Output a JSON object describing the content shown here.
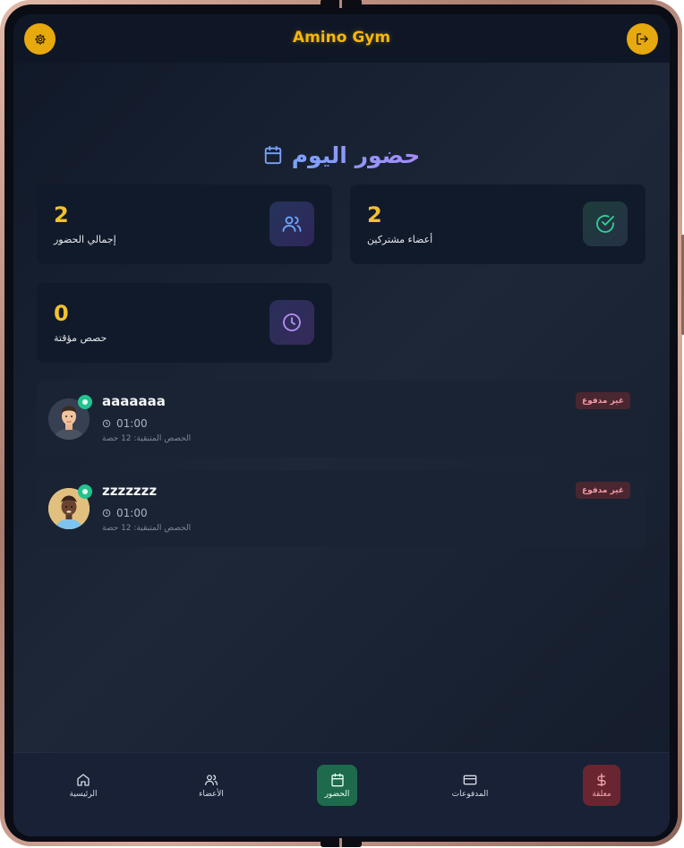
{
  "header": {
    "title": "Amino Gym",
    "settings_icon": "gear-icon",
    "logout_icon": "logout-icon",
    "accent_color": "#e6a90e"
  },
  "page": {
    "title": "حضور اليوم",
    "title_icon": "calendar-icon"
  },
  "stats": [
    {
      "value": "2",
      "label": "إجمالي الحضور",
      "icon": "users-icon"
    },
    {
      "value": "2",
      "label": "أعضاء مشتركين",
      "icon": "check-circle-icon"
    },
    {
      "value": "0",
      "label": "حصص مؤقتة",
      "icon": "clock-icon"
    }
  ],
  "attendance": [
    {
      "name": "aaaaaaa",
      "time": "01:00",
      "sessions": "الحصص المتبقية: 12 حصة",
      "status": "غير مدفوع"
    },
    {
      "name": "zzzzzzz",
      "time": "01:00",
      "sessions": "الحصص المتبقية: 12 حصة",
      "status": "غير مدفوع"
    }
  ],
  "nav": {
    "home": "الرئيسية",
    "members": "الأعضاء",
    "attendance": "الحضور",
    "payments": "المدفوعات",
    "pending": "معلقة",
    "active_tab": "attendance"
  }
}
